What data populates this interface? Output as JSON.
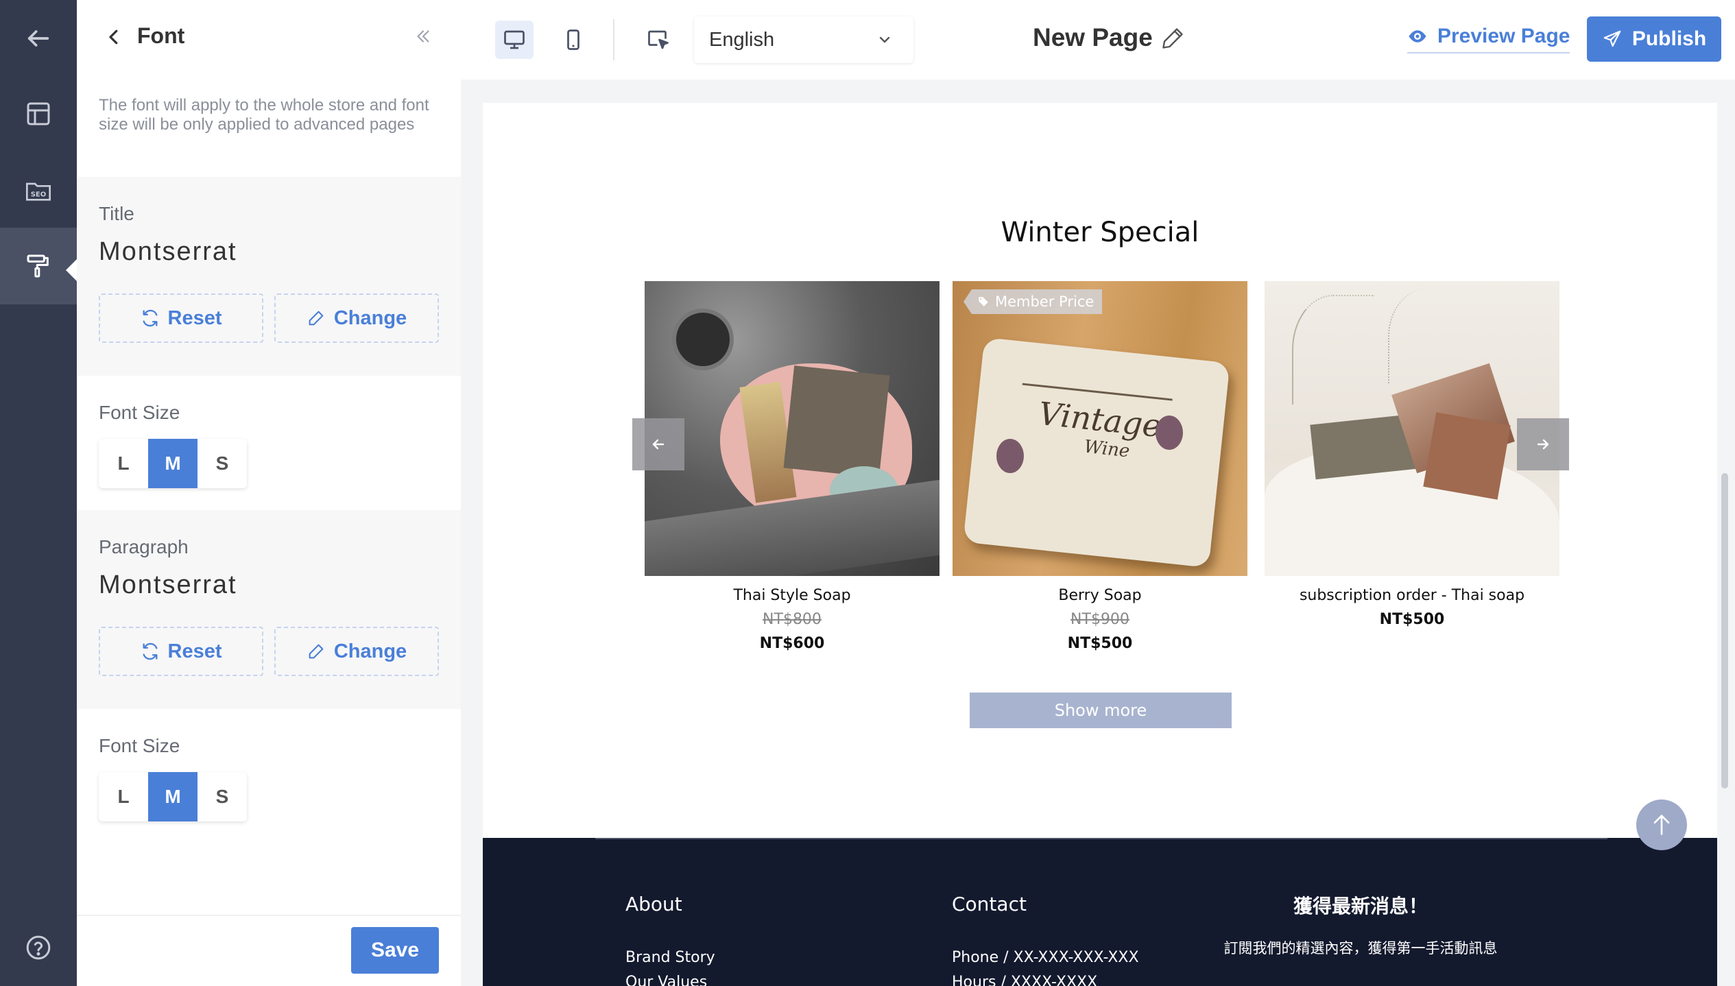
{
  "panel": {
    "title": "Font",
    "description": "The font will apply to the whole store and font size will be only applied to advanced pages",
    "title_section": {
      "label": "Title",
      "font": "Montserrat",
      "reset": "Reset",
      "change": "Change"
    },
    "title_size": {
      "label": "Font Size",
      "options": [
        "L",
        "M",
        "S"
      ],
      "selected": "M"
    },
    "paragraph_section": {
      "label": "Paragraph",
      "font": "Montserrat",
      "reset": "Reset",
      "change": "Change"
    },
    "paragraph_size": {
      "label": "Font Size",
      "options": [
        "L",
        "M",
        "S"
      ],
      "selected": "M"
    },
    "save": "Save"
  },
  "topbar": {
    "language": "English",
    "page_name": "New Page",
    "preview": "Preview Page",
    "publish": "Publish"
  },
  "preview": {
    "heading": "Winter Special",
    "products": [
      {
        "name": "Thai Style Soap",
        "old_price": "NT$800",
        "price": "NT$600",
        "badge": ""
      },
      {
        "name": "Berry Soap",
        "old_price": "NT$900",
        "price": "NT$500",
        "badge": "Member Price"
      },
      {
        "name": "subscription order - Thai soap",
        "old_price": "",
        "price": "NT$500",
        "badge": ""
      }
    ],
    "show_more": "Show more",
    "label_overlay": "Vintage",
    "label_overlay_sub": "Wine"
  },
  "footer": {
    "about": {
      "title": "About",
      "links": [
        "Brand Story",
        "Our Values"
      ]
    },
    "contact": {
      "title": "Contact",
      "links": [
        "Phone / XX-XXX-XXX-XXX",
        "Hours / XXXX-XXXX"
      ]
    },
    "newsletter": {
      "title": "獲得最新消息！",
      "text": "訂閱我們的精選內容，獲得第一手活動訊息"
    }
  },
  "colors": {
    "accent": "#4a7fd8",
    "rail": "#333a4e",
    "footer": "#141a2e"
  },
  "icons": [
    "back-arrow-icon",
    "layout-icon",
    "seo-folder-icon",
    "paint-roller-icon",
    "help-icon",
    "chevron-left-icon",
    "double-chevron-left-icon",
    "refresh-icon",
    "pencil-icon",
    "desktop-icon",
    "mobile-icon",
    "cursor-select-icon",
    "chevron-down-icon",
    "eye-icon",
    "paper-plane-icon",
    "tag-icon",
    "arrow-up-icon"
  ]
}
